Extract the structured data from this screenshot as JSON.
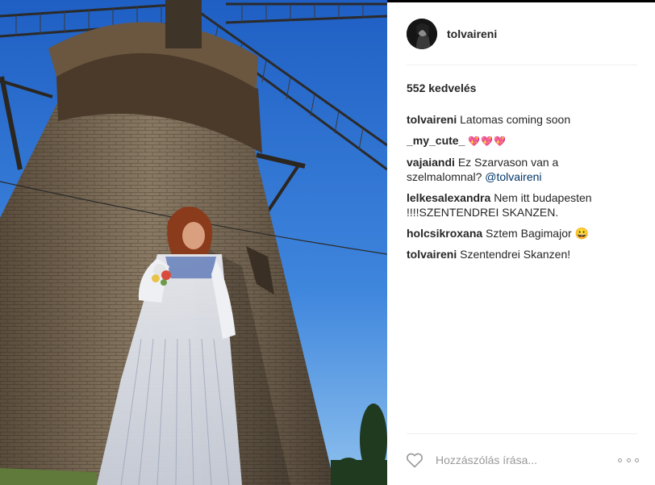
{
  "post": {
    "username": "tolvaireni",
    "likes": "552 kedvelés"
  },
  "comments": [
    {
      "user": "tolvaireni",
      "text": "Latomas coming soon",
      "mention": ""
    },
    {
      "user": "_my_cute_",
      "text": "💖💖💖",
      "mention": ""
    },
    {
      "user": "vajaiandi",
      "text": "Ez Szarvason van a szelmalomnal?",
      "mention": "@tolvaireni"
    },
    {
      "user": "lelkesalexandra",
      "text": "Nem itt budapesten !!!!SZENTENDREI SKANZEN.",
      "mention": ""
    },
    {
      "user": "holcsikroxana",
      "text": "Sztem Bagimajor 😀",
      "mention": ""
    },
    {
      "user": "tolvaireni",
      "text": "Szentendrei Skanzen!",
      "mention": ""
    }
  ],
  "footer": {
    "placeholder": "Hozzászólás írása..."
  },
  "icons": {
    "like": "heart-outline-icon",
    "more": "ellipsis-icon"
  },
  "colors": {
    "sky": "#3f7fd9",
    "brick": "#7a6a55",
    "mention": "#003569",
    "placeholder": "#999999"
  }
}
